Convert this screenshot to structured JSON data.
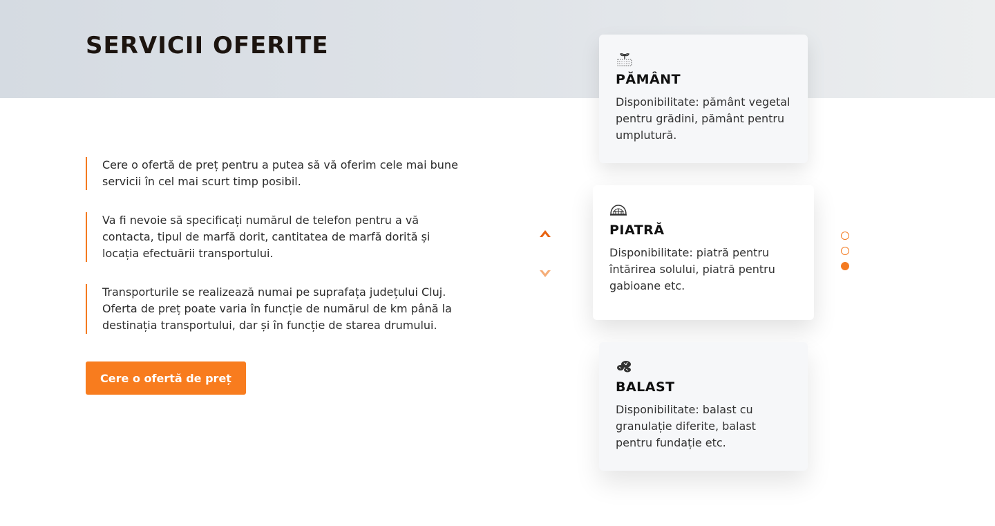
{
  "section": {
    "title": "SERVICII OFERITE"
  },
  "info": [
    {
      "text": "Cere o ofertă de preț pentru a putea să vă oferim cele mai bune servicii în cel mai scurt timp posibil."
    },
    {
      "text": "Va fi nevoie să specificați numărul de telefon pentru a vă contacta, tipul de marfă dorit, cantitatea de marfă dorită și locația efectuării transportului."
    },
    {
      "text": "Transporturile se realizează numai pe suprafața județului Cluj. Oferta de preț poate varia în funcție de numărul de km până la destinația transportului, dar și în funcție de starea drumului."
    }
  ],
  "cta": {
    "label": "Cere o ofertă de preț"
  },
  "colors": {
    "accent": "#f47a20",
    "button": "#f87c1e",
    "heading": "#1c140f"
  },
  "carousel": {
    "up_icon": "chevron-up-icon",
    "down_icon": "chevron-down-icon",
    "cards": [
      {
        "icon": "soil-plant-icon",
        "title": "PĂMÂNT",
        "text": "Disponibilitate: pământ vegetal pentru grădini, pământ pentru umplutură."
      },
      {
        "icon": "stone-pile-icon",
        "title": "PIATRĂ",
        "text": "Disponibilitate: piatră pentru întărirea solului, piatră pentru gabioane etc."
      },
      {
        "icon": "gravel-icon",
        "title": "BALAST",
        "text": "Disponibilitate: balast cu granulație diferite, balast pentru fundație etc."
      }
    ],
    "dots_count": 3,
    "active_dot": 3
  }
}
